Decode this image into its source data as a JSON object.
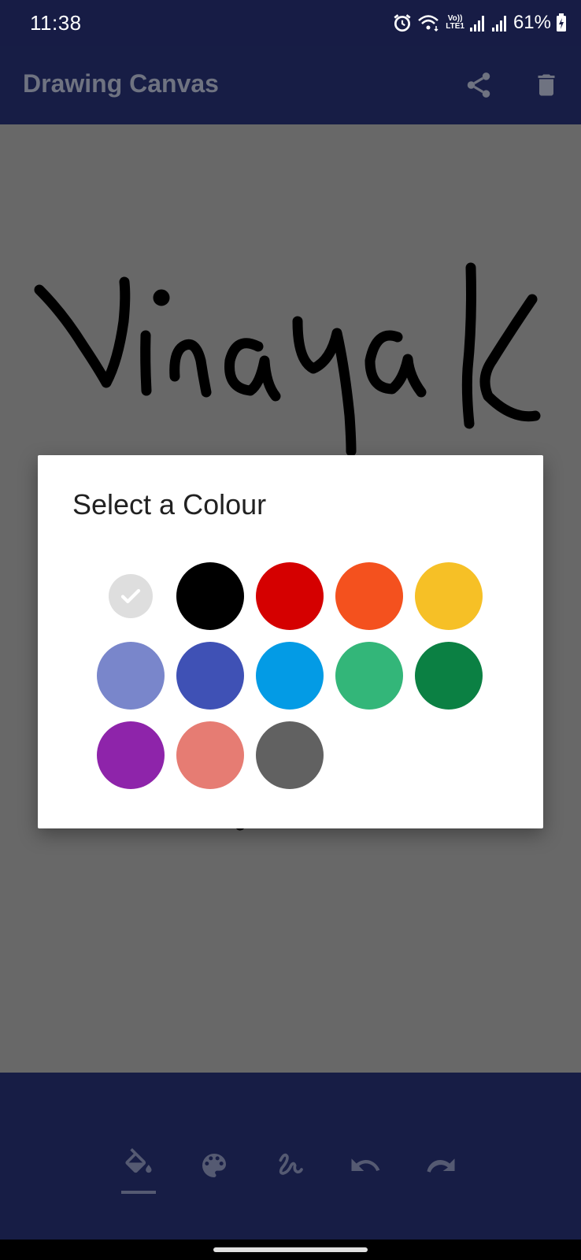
{
  "status_bar": {
    "time": "11:38",
    "network_label_top": "Vo))",
    "network_label_bottom": "LTE1",
    "battery": "61%",
    "icons": [
      "alarm-icon",
      "wifi-icon",
      "signal-icon",
      "signal-icon",
      "battery-charging-icon"
    ]
  },
  "app_bar": {
    "title": "Drawing Canvas",
    "actions": [
      "share-icon",
      "delete-icon"
    ]
  },
  "canvas": {
    "drawing_text": "Vinayak",
    "stroke_color": "#000000",
    "background_color": "#686868"
  },
  "dialog": {
    "title": "Select a Colour",
    "selected_index": 0,
    "colors": [
      {
        "name": "white",
        "hex": "#FFFFFF"
      },
      {
        "name": "black",
        "hex": "#000000"
      },
      {
        "name": "red",
        "hex": "#D50000"
      },
      {
        "name": "orange",
        "hex": "#F4511E"
      },
      {
        "name": "yellow",
        "hex": "#F6C026"
      },
      {
        "name": "lavender",
        "hex": "#7986CB"
      },
      {
        "name": "indigo",
        "hex": "#3F51B5"
      },
      {
        "name": "blue",
        "hex": "#039BE5"
      },
      {
        "name": "sage",
        "hex": "#33B679"
      },
      {
        "name": "green",
        "hex": "#0B8043"
      },
      {
        "name": "purple",
        "hex": "#8E24AA"
      },
      {
        "name": "salmon",
        "hex": "#E67C73"
      },
      {
        "name": "graphite",
        "hex": "#616161"
      }
    ]
  },
  "bottom_toolbar": {
    "tools": [
      "fill-bucket-icon",
      "palette-icon",
      "brush-stroke-icon",
      "undo-icon",
      "redo-icon"
    ],
    "active_tool": "fill-bucket-icon"
  },
  "colors": {
    "bar_background": "#171D45",
    "icon_muted": "#6F7381"
  }
}
